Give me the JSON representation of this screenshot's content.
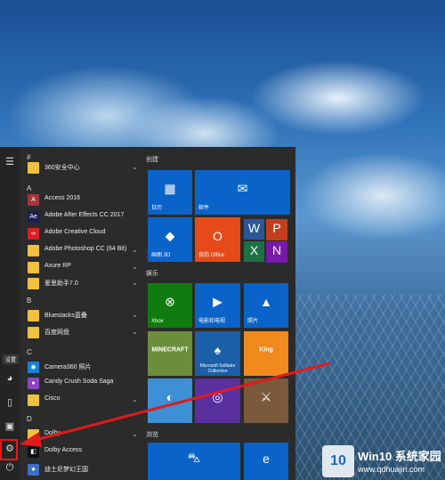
{
  "start_menu": {
    "rail_icons": [
      "hamburger-icon",
      "user-icon",
      "document-icon",
      "pictures-icon",
      "settings-icon",
      "power-icon"
    ],
    "tooltip": "设置",
    "apps": [
      {
        "type": "header",
        "text": "#"
      },
      {
        "type": "app",
        "label": "360安全中心",
        "icon": "folder-icon",
        "color": "#f0c040",
        "chevron": "⌄"
      },
      {
        "type": "header",
        "text": "A"
      },
      {
        "type": "app",
        "label": "Access 2016",
        "icon": "access-icon",
        "color": "#a4373a",
        "glyph": "A"
      },
      {
        "type": "app",
        "label": "Adobe After Effects CC 2017",
        "icon": "after-effects-icon",
        "color": "#1f1f55",
        "glyph": "Ae"
      },
      {
        "type": "app",
        "label": "Adobe Creative Cloud",
        "icon": "creative-cloud-icon",
        "color": "#da1f26",
        "glyph": "∞"
      },
      {
        "type": "app",
        "label": "Adobe Photoshop CC (64 Bit)",
        "icon": "folder-icon",
        "color": "#f0c040",
        "chevron": "⌄"
      },
      {
        "type": "app",
        "label": "Axure RP",
        "icon": "folder-icon",
        "color": "#f0c040",
        "chevron": "⌄"
      },
      {
        "type": "app",
        "label": "爱思助手7.0",
        "icon": "folder-icon",
        "color": "#f0c040",
        "chevron": "⌄"
      },
      {
        "type": "header",
        "text": "B"
      },
      {
        "type": "app",
        "label": "Bluestacks蓝叠",
        "icon": "folder-icon",
        "color": "#f0c040",
        "chevron": "⌄"
      },
      {
        "type": "app",
        "label": "百度网盘",
        "icon": "folder-icon",
        "color": "#f0c040",
        "chevron": "⌄"
      },
      {
        "type": "header",
        "text": "C"
      },
      {
        "type": "app",
        "label": "Camera360 照片",
        "icon": "camera360-icon",
        "color": "#1a7fd6",
        "glyph": "◉"
      },
      {
        "type": "app",
        "label": "Candy Crush Soda Saga",
        "icon": "candy-crush-icon",
        "color": "#8b46c1",
        "glyph": "●"
      },
      {
        "type": "app",
        "label": "Cisco",
        "icon": "folder-icon",
        "color": "#f0c040",
        "chevron": "⌄"
      },
      {
        "type": "header",
        "text": "D"
      },
      {
        "type": "app",
        "label": "Dolby",
        "icon": "folder-icon",
        "color": "#f0c040",
        "chevron": "⌄"
      },
      {
        "type": "app",
        "label": "Dolby Access",
        "icon": "dolby-icon",
        "color": "#111111",
        "glyph": "◧"
      },
      {
        "type": "app",
        "label": "迪士尼梦幻王国",
        "icon": "disney-icon",
        "color": "#3b6fc4",
        "glyph": "★"
      }
    ],
    "groups": [
      {
        "label": "创建"
      },
      {
        "label": "娱乐"
      },
      {
        "label": "浏览"
      }
    ],
    "tiles": [
      {
        "label": "日历",
        "icon": "calendar-icon",
        "glyph": "▦",
        "color": "#0a63c9"
      },
      {
        "label": "邮件",
        "icon": "mail-icon",
        "glyph": "✉",
        "color": "#0a63c9"
      },
      {
        "label": "画图 3D",
        "icon": "paint3d-icon",
        "glyph": "◆",
        "color": "#0a63c9"
      },
      {
        "label": "我的 Office",
        "icon": "office-icon",
        "glyph": "O",
        "color": "#e64a19"
      },
      {
        "label": "",
        "icon": "word-icon",
        "glyph": "W",
        "color": "#2b5797"
      },
      {
        "label": "",
        "icon": "powerpoint-icon",
        "glyph": "P",
        "color": "#c43e1c"
      },
      {
        "label": "",
        "icon": "excel-icon",
        "glyph": "X",
        "color": "#1e7145"
      },
      {
        "label": "",
        "icon": "onenote-icon",
        "glyph": "N",
        "color": "#7719aa"
      },
      {
        "label": "Xbox",
        "icon": "xbox-icon",
        "glyph": "⊗",
        "color": "#107c10"
      },
      {
        "label": "电影和电视",
        "icon": "movies-icon",
        "glyph": "▶",
        "color": "#0a63c9"
      },
      {
        "label": "照片",
        "icon": "photos-icon",
        "glyph": "▲",
        "color": "#0a63c9"
      },
      {
        "label": "",
        "icon": "minecraft-icon",
        "glyph": "MINECRAFT",
        "color": "#6b8e3a"
      },
      {
        "label": "Microsoft Solitaire Collection",
        "icon": "solitaire-icon",
        "glyph": "♠",
        "color": "#1a5fa8"
      },
      {
        "label": "",
        "icon": "king-icon",
        "glyph": "King",
        "color": "#f08a1c"
      },
      {
        "label": "",
        "icon": "disney-magic-kingdoms-icon",
        "glyph": "◐",
        "color": "#3d8fd6"
      },
      {
        "label": "",
        "icon": "bubble-witch-icon",
        "glyph": "◎",
        "color": "#5a2f9e"
      },
      {
        "label": "",
        "icon": "march-of-empires-icon",
        "glyph": "⚔",
        "color": "#7a5a3a"
      },
      {
        "label": "",
        "icon": "store-icon",
        "glyph": "⛍",
        "color": "#0a63c9"
      },
      {
        "label": "",
        "icon": "edge-icon",
        "glyph": "e",
        "color": "#0a63c9"
      }
    ]
  },
  "watermark": {
    "logo_text": "10",
    "title": "Win10 系统家园",
    "url": "www.qdhuajin.com"
  },
  "colors": {
    "arrow": "#e21a1a",
    "tile_blue": "#0a63c9",
    "menu_bg": "#2b2b2b"
  }
}
